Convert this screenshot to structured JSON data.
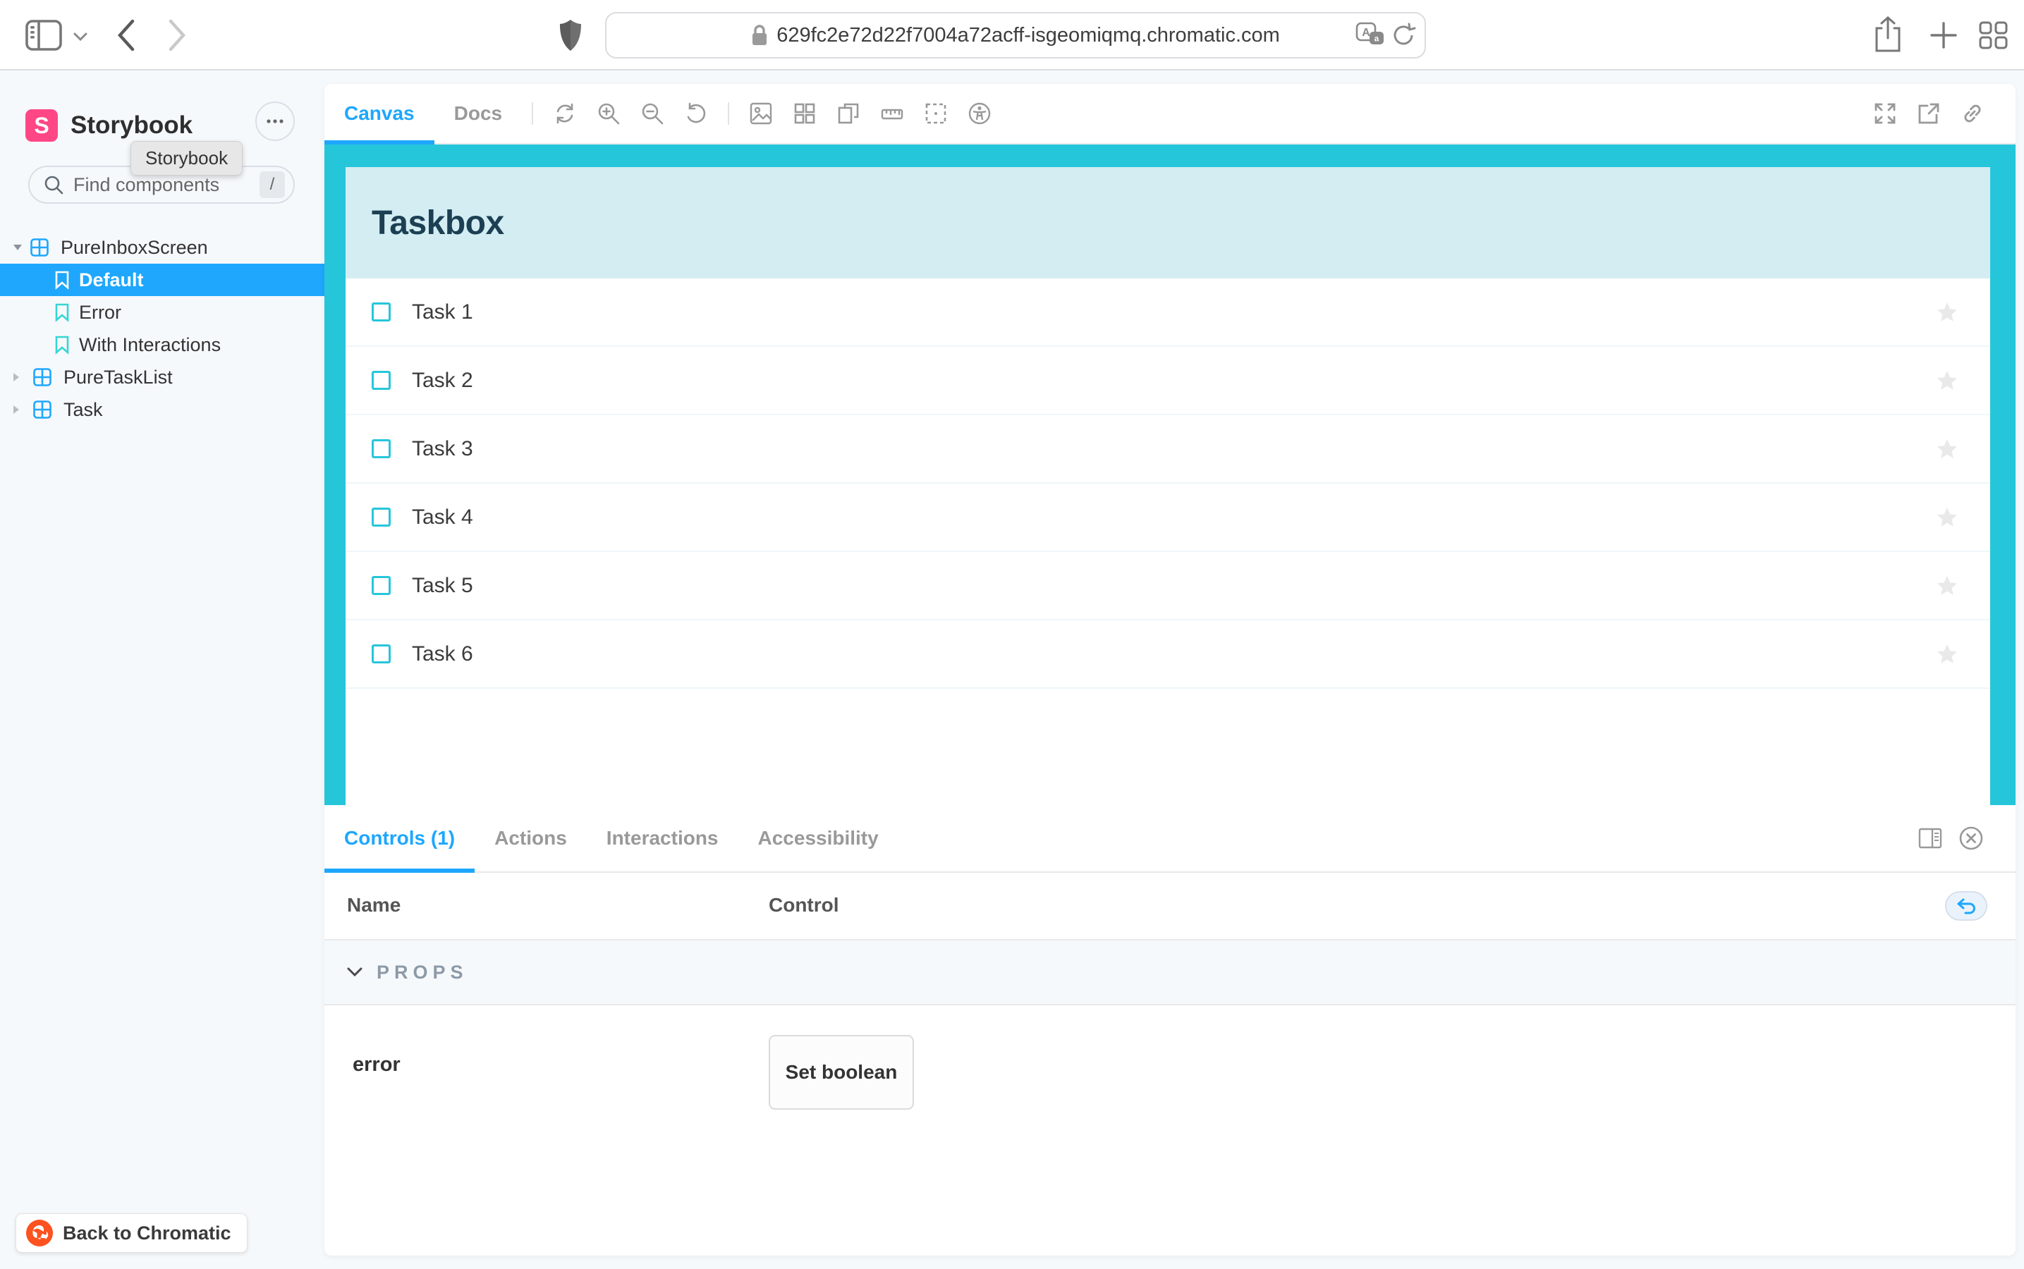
{
  "browser": {
    "url": "629fc2e72d22f7004a72acff-isgeomiqmq.chromatic.com"
  },
  "sidebar": {
    "brand_title": "Storybook",
    "tooltip": "Storybook",
    "search": {
      "placeholder": "Find components",
      "shortcut_key": "/"
    },
    "tree": {
      "items": [
        {
          "label": "PureInboxScreen",
          "type": "component",
          "expanded": true
        },
        {
          "label": "Default",
          "type": "story",
          "selected": true
        },
        {
          "label": "Error",
          "type": "story",
          "selected": false
        },
        {
          "label": "With Interactions",
          "type": "story",
          "selected": false
        },
        {
          "label": "PureTaskList",
          "type": "component",
          "expanded": false
        },
        {
          "label": "Task",
          "type": "component",
          "expanded": false
        }
      ]
    },
    "back_button_label": "Back to Chromatic"
  },
  "toolbar": {
    "canvas_tab": "Canvas",
    "docs_tab": "Docs"
  },
  "preview": {
    "app_title": "Taskbox",
    "tasks": [
      "Task 1",
      "Task 2",
      "Task 3",
      "Task 4",
      "Task 5",
      "Task 6"
    ]
  },
  "panel": {
    "tabs": {
      "controls": "Controls (1)",
      "actions": "Actions",
      "interactions": "Interactions",
      "accessibility": "Accessibility"
    },
    "name_column": "Name",
    "control_column": "Control",
    "props_section": "PROPS",
    "error_row": {
      "name": "error",
      "control_label": "Set boolean"
    }
  },
  "colors": {
    "accent_blue": "#1EA7FD",
    "taskbox_cyan": "#26C6DA",
    "taskbox_header_bg": "#D3EDF3",
    "story_teal": "#37D5D3",
    "storybook_pink": "#FF4785",
    "chromatic_orange": "#FC521F"
  }
}
